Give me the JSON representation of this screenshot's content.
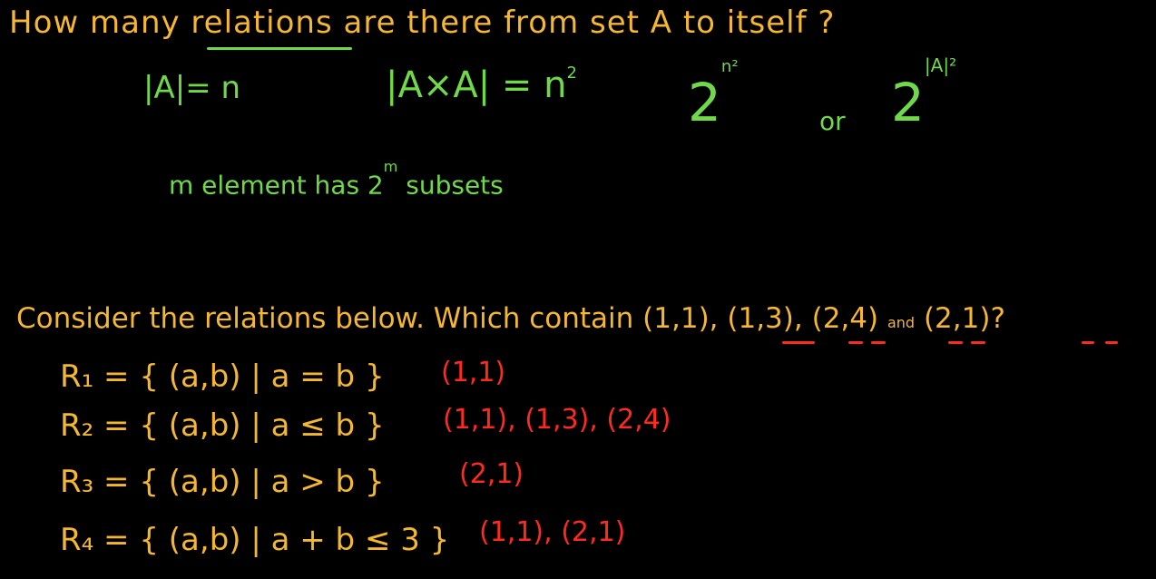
{
  "question": {
    "prefix": "How many",
    "underlined": "relations",
    "suffix": "are there from set A to itself ?"
  },
  "notes": {
    "card_a": "|A|= n",
    "card_axa": "|A×A| = n",
    "card_axa_exp": "2",
    "power_base": "2",
    "power_exp": "n²",
    "or": "or",
    "power_base_2": "2",
    "power_exp_2": "|A|²",
    "subsets_prefix": "m element has 2",
    "subsets_exp": "m",
    "subsets_suffix": "subsets"
  },
  "consider": {
    "text_prefix": "Consider the relations below. Which contain",
    "pair_1": "(1,1)",
    "pair_2": "(1,3)",
    "pair_3": "(2,4)",
    "and_word": "and",
    "pair_4": "(2,1)",
    "end": "?"
  },
  "relations": [
    {
      "def": "R₁ = { (a,b) | a = b }",
      "answer": "(1,1)"
    },
    {
      "def": "R₂ = { (a,b) | a ≤ b }",
      "answer": "(1,1), (1,3), (2,4)"
    },
    {
      "def": "R₃ = { (a,b) | a > b }",
      "answer": "(2,1)"
    },
    {
      "def": "R₄ = { (a,b) | a + b ≤ 3 }",
      "answer": "(1,1), (2,1)"
    }
  ],
  "colors": {
    "yellow": "#f5b630",
    "green": "#6fd94a",
    "red": "#ff2a1f",
    "background": "#000000"
  }
}
